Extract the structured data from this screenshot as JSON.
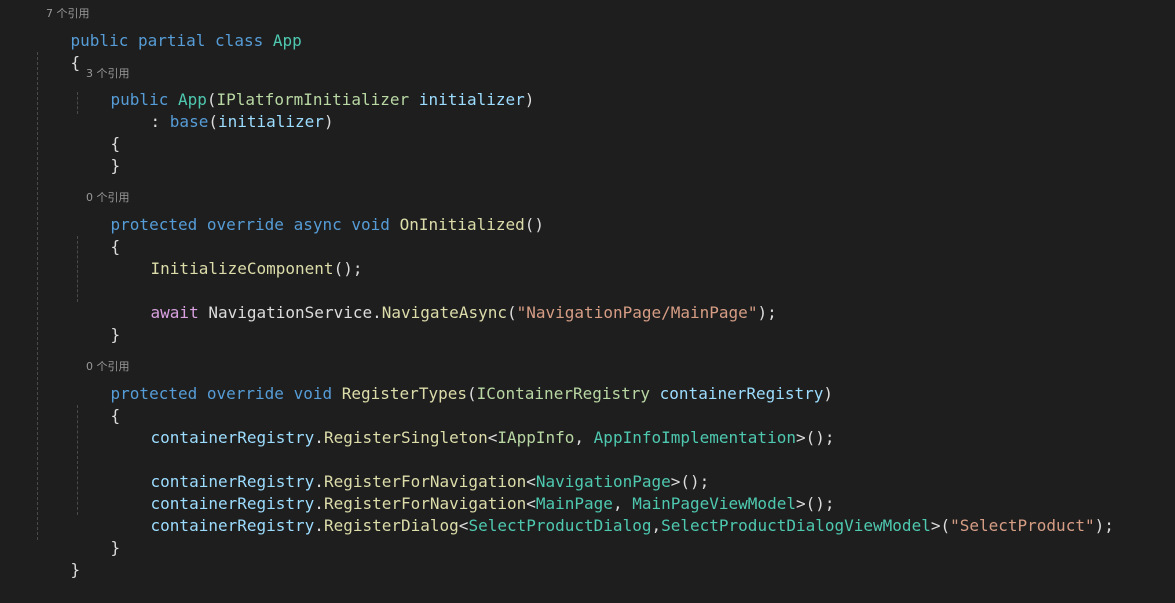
{
  "code_lens": {
    "top": "7 个引用",
    "ctor": "3 个引用",
    "on_initialized": "0 个引用",
    "register_types": "0 个引用"
  },
  "tokens": {
    "public": "public",
    "partial": "partial",
    "class": "class",
    "App": "App",
    "open_brace": "{",
    "close_brace": "}",
    "ctor_public": "public",
    "ctor_name": "App",
    "open_paren": "(",
    "IPlatformInitializer": "IPlatformInitializer",
    "initializer": "initializer",
    "close_paren": ")",
    "colon": ": ",
    "base": "base",
    "protected": "protected",
    "override": "override",
    "async": "async",
    "void": "void",
    "OnInitialized": "OnInitialized",
    "empty_parens": "()",
    "InitializeComponent": "InitializeComponent",
    "call_end": "();",
    "await": "await",
    "NavigationService": "NavigationService",
    "dot": ".",
    "NavigateAsync": "NavigateAsync",
    "nav_string": "\"NavigationPage/MainPage\"",
    "paren_semicolon": ");",
    "RegisterTypes": "RegisterTypes",
    "IContainerRegistry": "IContainerRegistry",
    "containerRegistry": "containerRegistry",
    "RegisterSingleton": "RegisterSingleton",
    "lt": "<",
    "gt_call": ">();",
    "IAppInfo": "IAppInfo",
    "comma_space": ", ",
    "comma": ",",
    "AppInfoImplementation": "AppInfoImplementation",
    "RegisterForNavigation": "RegisterForNavigation",
    "NavigationPage": "NavigationPage",
    "MainPage": "MainPage",
    "MainPageViewModel": "MainPageViewModel",
    "RegisterDialog": "RegisterDialog",
    "SelectProductDialog": "SelectProductDialog",
    "SelectProductDialogViewModel": "SelectProductDialogViewModel",
    "gt_open": ">(",
    "dialog_string": "\"SelectProduct\""
  },
  "colors": {
    "background": "#1e1e1e",
    "keyword": "#569cd6",
    "control_keyword": "#d8a0df",
    "type": "#4ec9b0",
    "interface": "#b8d7a3",
    "method": "#dcdcaa",
    "identifier": "#9cdcfe",
    "string": "#d69d85",
    "codelens": "#999999"
  }
}
